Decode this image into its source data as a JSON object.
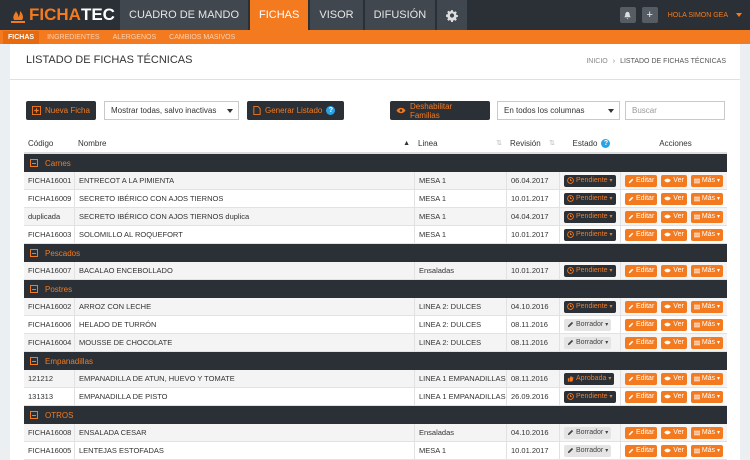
{
  "app": {
    "logo_prefix": "FICHA",
    "logo_suffix": "TEC"
  },
  "nav": [
    {
      "label": "CUADRO DE MANDO",
      "active": false
    },
    {
      "label": "FICHAS",
      "active": true
    },
    {
      "label": "VISOR",
      "active": false
    },
    {
      "label": "DIFUSIÓN",
      "active": false
    }
  ],
  "nav_settings_icon": "gear-icon",
  "top_right": {
    "bell_icon": "bell-icon",
    "plus_icon": "plus-icon",
    "user_label": "HOLA SIMON GEA"
  },
  "subnav": [
    {
      "label": "FICHAS",
      "active": true
    },
    {
      "label": "INGREDIENTES",
      "active": false
    },
    {
      "label": "ALERGENOS",
      "active": false
    },
    {
      "label": "CAMBIOS MASIVOS",
      "active": false
    }
  ],
  "header": {
    "title": "LISTADO DE FICHAS TÉCNICAS",
    "breadcrumb": [
      "INICIO",
      "›",
      "LISTADO DE FICHAS TÉCNICAS"
    ]
  },
  "toolbar": {
    "new_label": "Nueva Ficha",
    "filter_value": "Mostrar todas, salvo inactivas",
    "generate_label": "Generar Listado",
    "families_label": "Deshabilitar Familias",
    "columns_value": "En todos los columnas",
    "search_placeholder": "Buscar"
  },
  "columns": {
    "code": "Código",
    "name": "Nombre",
    "line": "Linea",
    "revision": "Revisión",
    "status": "Estado",
    "actions": "Acciones"
  },
  "actions": {
    "edit": "Editar",
    "view": "Ver",
    "more": "Más"
  },
  "groups": [
    {
      "name": "Carnes",
      "rows": [
        {
          "code": "FICHA16001",
          "name": "ENTRECOT A LA PIMIENTA",
          "line": "MESA 1",
          "revision": "06.04.2017",
          "status": "Pendiente",
          "kind": "p"
        },
        {
          "code": "FICHA16009",
          "name": "SECRETO IBÉRICO CON AJOS TIERNOS",
          "line": "MESA 1",
          "revision": "10.01.2017",
          "status": "Pendiente",
          "kind": "p"
        },
        {
          "code": "duplicada",
          "name": "SECRETO IBÉRICO CON AJOS TIERNOS duplica",
          "line": "MESA 1",
          "revision": "04.04.2017",
          "status": "Pendiente",
          "kind": "p"
        },
        {
          "code": "FICHA16003",
          "name": "SOLOMILLO AL ROQUEFORT",
          "line": "MESA 1",
          "revision": "10.01.2017",
          "status": "Pendiente",
          "kind": "p"
        }
      ]
    },
    {
      "name": "Pescados",
      "rows": [
        {
          "code": "FICHA16007",
          "name": "BACALAO ENCEBOLLADO",
          "line": "Ensaladas",
          "revision": "10.01.2017",
          "status": "Pendiente",
          "kind": "p"
        }
      ]
    },
    {
      "name": "Postres",
      "rows": [
        {
          "code": "FICHA16002",
          "name": "ARROZ CON LECHE",
          "line": "LINEA 2: DULCES",
          "revision": "04.10.2016",
          "status": "Pendiente",
          "kind": "p"
        },
        {
          "code": "FICHA16006",
          "name": "HELADO DE TURRÓN",
          "line": "LINEA 2: DULCES",
          "revision": "08.11.2016",
          "status": "Borrador",
          "kind": "b"
        },
        {
          "code": "FICHA16004",
          "name": "MOUSSE DE CHOCOLATE",
          "line": "LINEA 2: DULCES",
          "revision": "08.11.2016",
          "status": "Borrador",
          "kind": "b"
        }
      ]
    },
    {
      "name": "Empanadillas",
      "rows": [
        {
          "code": "121212",
          "name": "EMPANADILLA DE ATUN, HUEVO Y TOMATE",
          "line": "LINEA 1 EMPANADILLAS",
          "revision": "08.11.2016",
          "status": "Aprobada",
          "kind": "a"
        },
        {
          "code": "131313",
          "name": "EMPANADILLA DE PISTO",
          "line": "LINEA 1 EMPANADILLAS",
          "revision": "26.09.2016",
          "status": "Pendiente",
          "kind": "p"
        }
      ]
    },
    {
      "name": "OTROS",
      "rows": [
        {
          "code": "FICHA16008",
          "name": "ENSALADA CESAR",
          "line": "Ensaladas",
          "revision": "04.10.2016",
          "status": "Borrador",
          "kind": "b"
        },
        {
          "code": "FICHA16005",
          "name": "LENTEJAS ESTOFADAS",
          "line": "MESA 1",
          "revision": "10.01.2017",
          "status": "Borrador",
          "kind": "b"
        }
      ]
    }
  ],
  "colors": {
    "accent": "#f47a20",
    "dark": "#2b3036",
    "info": "#2aa3e6"
  }
}
